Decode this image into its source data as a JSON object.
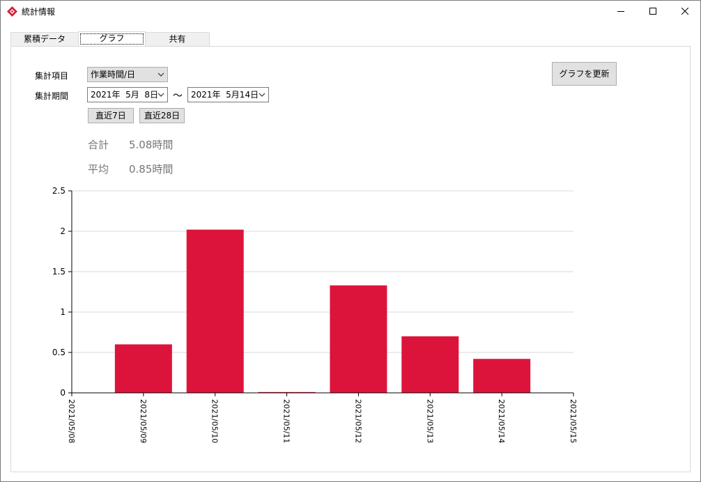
{
  "window": {
    "title": "統計情報",
    "controls": [
      "minimize",
      "maximize",
      "close"
    ]
  },
  "tabs": [
    {
      "label": "累積データ",
      "active": false
    },
    {
      "label": "グラフ",
      "active": true
    },
    {
      "label": "共有",
      "active": false
    }
  ],
  "form": {
    "item_label": "集計項目",
    "item_value": "作業時間/日",
    "period_label": "集計期間",
    "start_date": "2021年  5月  8日",
    "tilde": "～",
    "end_date": "2021年  5月14日",
    "recent7_label": "直近7日",
    "recent28_label": "直近28日",
    "update_label": "グラフを更新"
  },
  "stats": {
    "total_label": "合計",
    "total_value": "5.08時間",
    "average_label": "平均",
    "average_value": "0.85時間"
  },
  "chart_data": {
    "type": "bar",
    "x_ticks": [
      "2021/05/08",
      "2021/05/09",
      "2021/05/10",
      "2021/05/11",
      "2021/05/12",
      "2021/05/13",
      "2021/05/14",
      "2021/05/15"
    ],
    "categories": [
      "2021/05/09",
      "2021/05/10",
      "2021/05/11",
      "2021/05/12",
      "2021/05/13",
      "2021/05/14"
    ],
    "values": [
      0.6,
      2.02,
      0.01,
      1.33,
      0.7,
      0.42
    ],
    "y_ticks": [
      "0",
      "0.5",
      "1",
      "1.5",
      "2",
      "2.5"
    ],
    "ylim": [
      0,
      2.5
    ],
    "bar_color": "#dc143c",
    "grid": true
  }
}
